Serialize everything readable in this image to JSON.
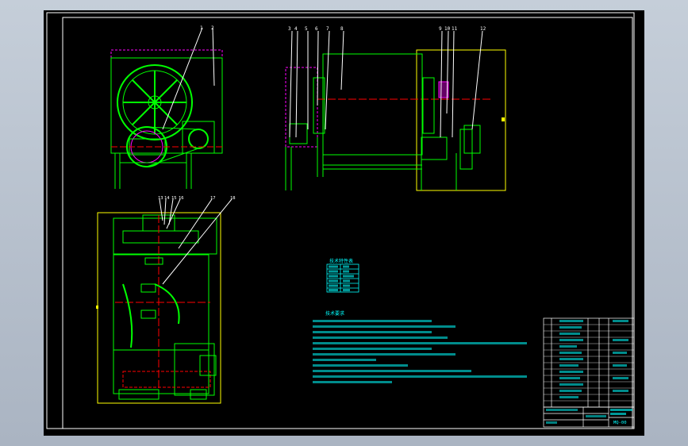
{
  "drawing": {
    "callouts_front": [
      "1",
      "2"
    ],
    "callouts_side": [
      "3",
      "4",
      "5",
      "6",
      "7",
      "8",
      "9",
      "10",
      "11",
      "12"
    ],
    "callouts_plan": [
      "13",
      "14",
      "15",
      "16",
      "17",
      "18"
    ],
    "drawing_number": "MQ-00",
    "table_caption": "技术特性表",
    "notes_heading": "技术要求"
  },
  "colors": {
    "background": "#000000",
    "frame": "#ffffff",
    "geometry": "#00ff00",
    "leaders": "#ffffff",
    "centerline": "#ff0000",
    "hidden": "#ff00ff",
    "outline": "#ffff00",
    "text": "#00ffff"
  }
}
